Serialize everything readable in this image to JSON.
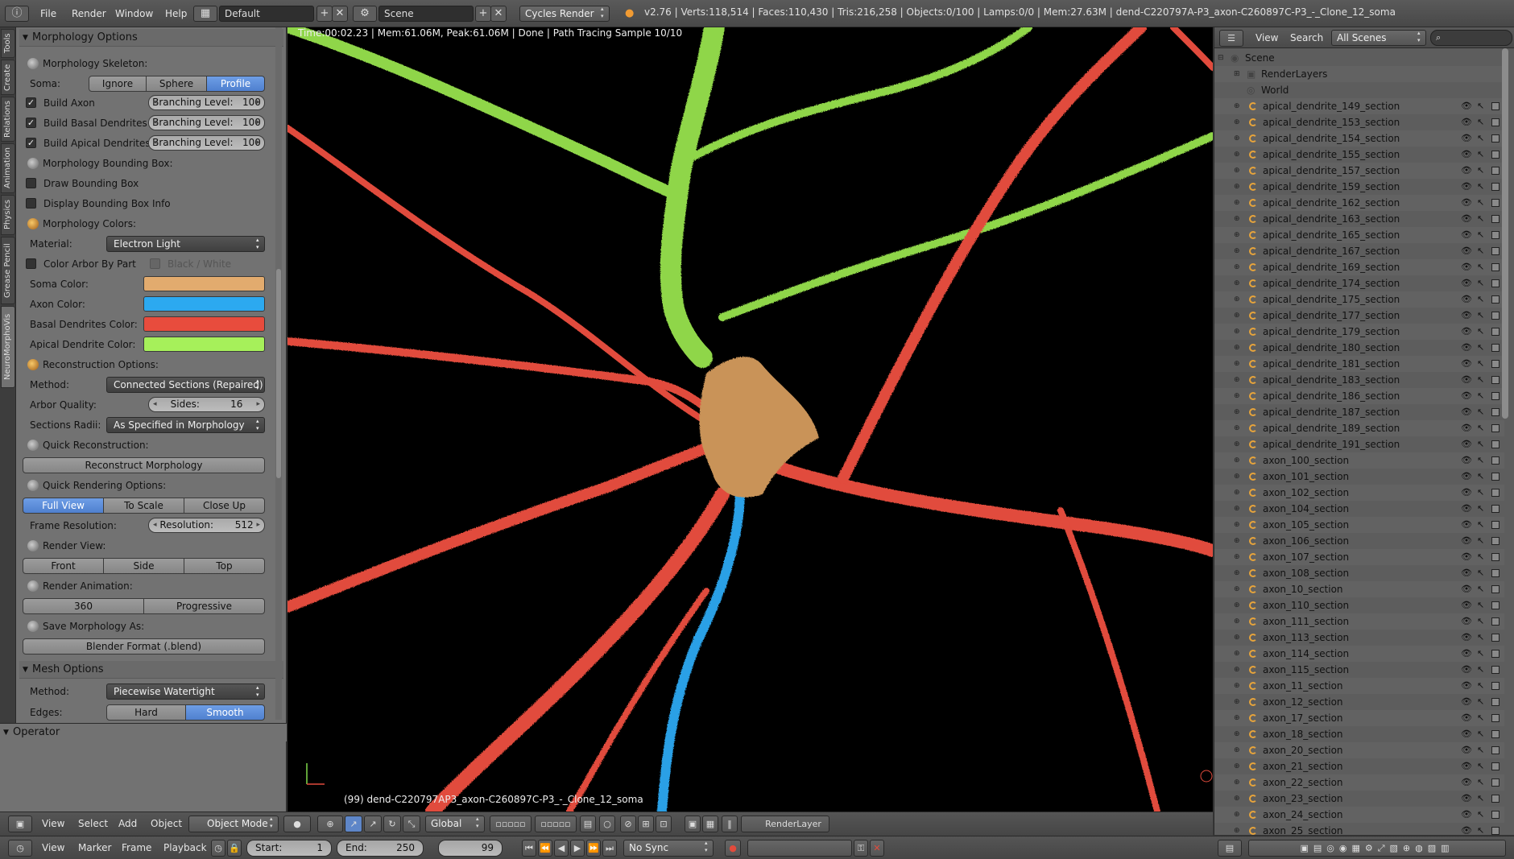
{
  "topbar": {
    "menus": [
      "File",
      "Render",
      "Window",
      "Help"
    ],
    "screen_layout": "Default",
    "scene": "Scene",
    "render_engine": "Cycles Render",
    "stats": "v2.76 | Verts:118,514 | Faces:110,430 | Tris:216,258 | Objects:0/100 | Lamps:0/0 | Mem:27.63M | dend-C220797A-P3_axon-C260897C-P3_-_Clone_12_soma"
  },
  "tool_tabs": [
    "Tools",
    "Create",
    "Relations",
    "Animation",
    "Physics",
    "Grease Pencil",
    "NeuroMorphoVis"
  ],
  "morphology_panel": {
    "title": "Morphology Options",
    "skeleton_label": "Morphology Skeleton:",
    "soma_label": "Soma:",
    "soma_options": [
      "Ignore",
      "Sphere",
      "Profile"
    ],
    "build_axon": "Build Axon",
    "build_basal": "Build Basal Dendrites",
    "build_apical": "Build Apical Dendrites",
    "branching_label": "Branching Level:",
    "branching_axon": "100",
    "branching_basal": "100",
    "branching_apical": "100",
    "bbox_label": "Morphology Bounding Box:",
    "draw_bbox": "Draw Bounding Box",
    "display_bbox_info": "Display Bounding Box Info",
    "colors_label": "Morphology Colors:",
    "material_label": "Material:",
    "material_value": "Electron Light",
    "color_arbor": "Color Arbor By Part",
    "black_white": "Black / White",
    "soma_color_label": "Soma Color:",
    "axon_color_label": "Axon Color:",
    "basal_color_label": "Basal Dendrites  Color:",
    "apical_color_label": "Apical Dendrite Color:",
    "colors": {
      "soma": "#e2ab6e",
      "axon": "#2ca9f0",
      "basal": "#e84c3d",
      "apical": "#a6f05a"
    },
    "recon_label": "Reconstruction Options:",
    "method_label": "Method:",
    "method_value": "Connected Sections (Repaired)",
    "arbor_quality_label": "Arbor Quality:",
    "sides_label": "Sides:",
    "sides_value": "16",
    "radii_label": "Sections Radii:",
    "radii_value": "As Specified in Morphology",
    "quick_recon_label": "Quick Reconstruction:",
    "reconstruct_button": "Reconstruct Morphology",
    "quick_render_label": "Quick Rendering Options:",
    "render_options": [
      "Full View",
      "To Scale",
      "Close Up"
    ],
    "frame_res_label": "Frame Resolution:",
    "resolution_label": "Resolution:",
    "resolution_value": "512",
    "render_view_label": "Render View:",
    "render_views": [
      "Front",
      "Side",
      "Top"
    ],
    "render_anim_label": "Render Animation:",
    "anim_options": [
      "360",
      "Progressive"
    ],
    "save_label": "Save Morphology As:",
    "save_button": "Blender Format (.blend)"
  },
  "mesh_panel": {
    "title": "Mesh Options",
    "method_label": "Method:",
    "method_value": "Piecewise Watertight",
    "edges_label": "Edges:",
    "edges_options": [
      "Hard",
      "Smooth"
    ]
  },
  "operator_panel": {
    "title": "Operator"
  },
  "viewport": {
    "info": "Time:00:02.23 | Mem:61.06M, Peak:61.06M | Done | Path Tracing Sample 10/10",
    "object": "(99) dend-C220797AP3_axon-C260897C-P3_-_Clone_12_soma"
  },
  "outliner": {
    "menus": [
      "View",
      "Search"
    ],
    "filter": "All Scenes",
    "scene": "Scene",
    "render_layers": "RenderLayers",
    "world": "World",
    "items": [
      "apical_dendrite_149_section",
      "apical_dendrite_153_section",
      "apical_dendrite_154_section",
      "apical_dendrite_155_section",
      "apical_dendrite_157_section",
      "apical_dendrite_159_section",
      "apical_dendrite_162_section",
      "apical_dendrite_163_section",
      "apical_dendrite_165_section",
      "apical_dendrite_167_section",
      "apical_dendrite_169_section",
      "apical_dendrite_174_section",
      "apical_dendrite_175_section",
      "apical_dendrite_177_section",
      "apical_dendrite_179_section",
      "apical_dendrite_180_section",
      "apical_dendrite_181_section",
      "apical_dendrite_183_section",
      "apical_dendrite_186_section",
      "apical_dendrite_187_section",
      "apical_dendrite_189_section",
      "apical_dendrite_191_section",
      "axon_100_section",
      "axon_101_section",
      "axon_102_section",
      "axon_104_section",
      "axon_105_section",
      "axon_106_section",
      "axon_107_section",
      "axon_108_section",
      "axon_10_section",
      "axon_110_section",
      "axon_111_section",
      "axon_113_section",
      "axon_114_section",
      "axon_115_section",
      "axon_11_section",
      "axon_12_section",
      "axon_17_section",
      "axon_18_section",
      "axon_20_section",
      "axon_21_section",
      "axon_22_section",
      "axon_23_section",
      "axon_24_section",
      "axon_25_section"
    ]
  },
  "view3d_header": {
    "menus": [
      "View",
      "Select",
      "Add",
      "Object"
    ],
    "mode": "Object Mode",
    "orientation": "Global",
    "render_layer": "RenderLayer"
  },
  "timeline": {
    "menus": [
      "View",
      "Marker",
      "Frame",
      "Playback"
    ],
    "start_label": "Start:",
    "start_value": "1",
    "end_label": "End:",
    "end_value": "250",
    "current_frame": "99",
    "sync": "No Sync"
  }
}
